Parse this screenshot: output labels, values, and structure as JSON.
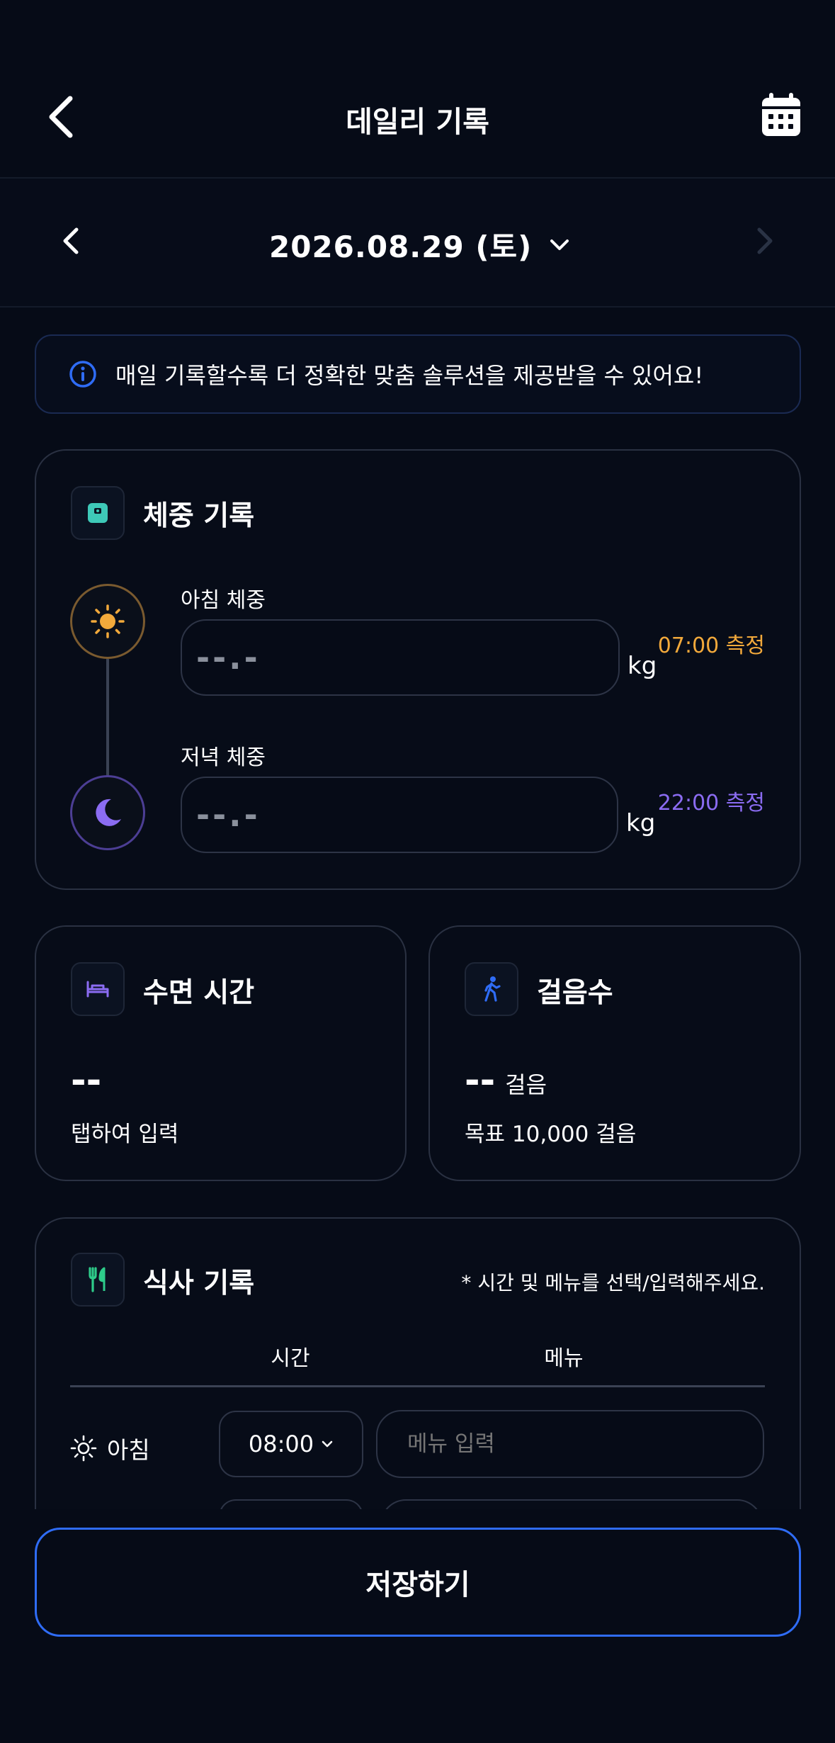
{
  "header": {
    "title": "데일리 기록"
  },
  "date_bar": {
    "date": "2026.08.29 (토)"
  },
  "notice": {
    "text": "매일 기록할수록 더 정확한 맞춤 솔루션을 제공받을 수 있어요!"
  },
  "weight": {
    "title": "체중 기록",
    "morning": {
      "label": "아침 체중",
      "placeholder": "--.-",
      "unit": "kg",
      "time": "07:00 측정",
      "time_color": "#f2a93b"
    },
    "evening": {
      "label": "저녁 체중",
      "placeholder": "--.-",
      "unit": "kg",
      "time": "22:00 측정",
      "time_color": "#8b6cf2"
    }
  },
  "sleep": {
    "title": "수면 시간",
    "value": "--",
    "hint": "탭하여 입력"
  },
  "steps": {
    "title": "걸음수",
    "value": "--",
    "unit": "걸음",
    "goal": "목표 10,000 걸음"
  },
  "meal": {
    "title": "식사 기록",
    "note": "* 시간 및 메뉴를 선택/입력해주세요.",
    "columns": {
      "time": "시간",
      "menu": "메뉴"
    },
    "rows": [
      {
        "name": "아침",
        "time": "08:00",
        "menu_placeholder": "메뉴 입력"
      }
    ]
  },
  "save_button": "저장하기",
  "colors": {
    "accent": "#2f6cf6",
    "background": "#060b17",
    "sun": "#f2a93b",
    "moon": "#8b6cf2",
    "teal": "#3ec9b8",
    "green": "#2ecc8a"
  }
}
